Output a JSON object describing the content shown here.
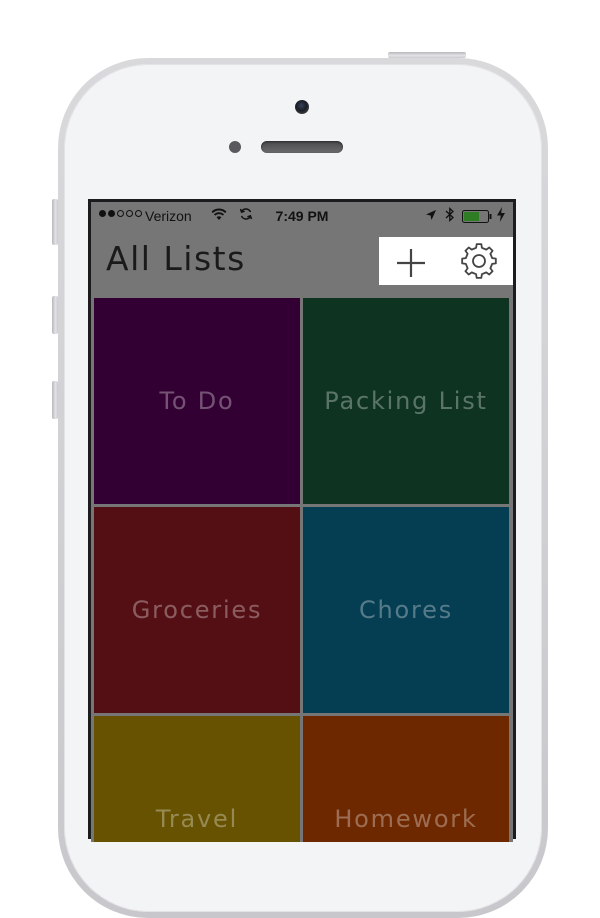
{
  "status_bar": {
    "carrier": "Verizon",
    "time": "7:49 PM",
    "signal_strength": 2,
    "signal_max": 5
  },
  "nav": {
    "title": "All Lists",
    "add_icon": "plus-icon",
    "settings_icon": "gear-icon"
  },
  "lists": [
    {
      "name": "To Do",
      "color": "#330033"
    },
    {
      "name": "Packing List",
      "color": "#0e3321"
    },
    {
      "name": "Groceries",
      "color": "#540f14"
    },
    {
      "name": "Chores",
      "color": "#053d52"
    },
    {
      "name": "Travel",
      "color": "#665200"
    },
    {
      "name": "Homework",
      "color": "#6e2800"
    }
  ]
}
